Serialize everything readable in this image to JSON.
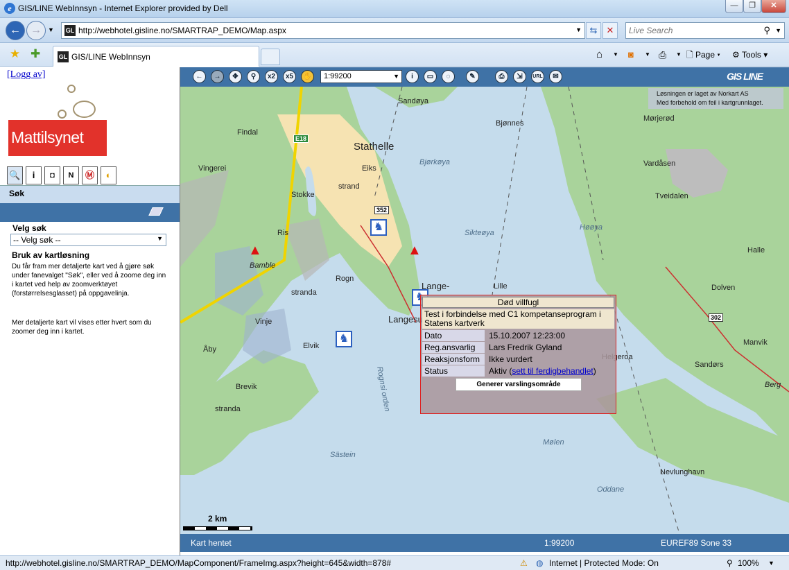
{
  "window": {
    "title": "GIS/LINE WebInnsyn - Internet Explorer provided by Dell"
  },
  "nav": {
    "url": "http://webhotel.gisline.no/SMARTRAP_DEMO/Map.aspx",
    "search_placeholder": "Live Search"
  },
  "tab": {
    "label": "GIS/LINE WebInnsyn"
  },
  "commands": {
    "page": "Page",
    "tools": "Tools"
  },
  "left": {
    "logout": "[Logg av]",
    "logo_text": "Mattilsynet",
    "search_header": "Søk",
    "velg_label": "Velg søk",
    "velg_value": "-- Velg søk --",
    "usage_title": "Bruk av kartløsning",
    "usage_text": "Du får fram mer detaljerte kart ved å gjøre søk under fanevalget \"Søk\", eller ved å zoome deg inn i kartet ved help av zoomverktøyet (forstørrelsesglasset) på oppgavelinja.",
    "usage_more": "Mer detaljerte kart vil vises etter hvert som du zoomer deg inn i kartet."
  },
  "map": {
    "scale_value": "1:99200",
    "brand": "GIS LINE",
    "notice_line1": "Løsningen er laget av Norkart AS",
    "notice_line2": "Med forbehold om feil i kartgrunnlaget.",
    "scalebar_label": "2 km",
    "labels": [
      "Sandøya",
      "Findal",
      "Stathelle",
      "Bjønnes",
      "Mørjerød",
      "Vardåsen",
      "Eiks",
      "Bjørkøya",
      "Vingerei",
      "strand",
      "Stokke",
      "Tveidalen",
      "Sikteøya",
      "Høøya",
      "Halle",
      "Ris",
      "Bamble",
      "Rogn",
      "Lange-",
      "Lille",
      "Dolven",
      "stranda",
      "Vinje",
      "Åby",
      "Elvik",
      "Brevik",
      "stranda",
      "Mølen",
      "Nevlunghavn",
      "Oddane",
      "Sandørs",
      "Manvik",
      "Berg",
      "Helgeroa",
      "Sästein",
      "Rognsi orden",
      "Langesund"
    ],
    "road_labels": [
      "E18",
      "352",
      "302"
    ]
  },
  "popup": {
    "title": "Død villfugl",
    "description": "Test i forbindelse med C1 kompetanseprogram i Statens kartverk",
    "rows": [
      {
        "key": "Dato",
        "value": "15.10.2007 12:23:00"
      },
      {
        "key": "Reg.ansvarlig",
        "value": "Lars Fredrik Gyland"
      },
      {
        "key": "Reaksjonsform",
        "value": "Ikke vurdert"
      },
      {
        "key": "Status",
        "value": "Aktiv (",
        "link": "sett til ferdigbehandlet",
        "suffix": ")"
      }
    ],
    "button": "Generer varslingsområde"
  },
  "map_status": {
    "left": "Kart hentet",
    "scale": "1:99200",
    "crs": "EUREF89 Sone 33"
  },
  "ie_status": {
    "url": "http://webhotel.gisline.no/SMARTRAP_DEMO/MapComponent/FrameImg.aspx?height=645&width=878#",
    "zone": "Internet | Protected Mode: On",
    "zoom": "100%"
  }
}
